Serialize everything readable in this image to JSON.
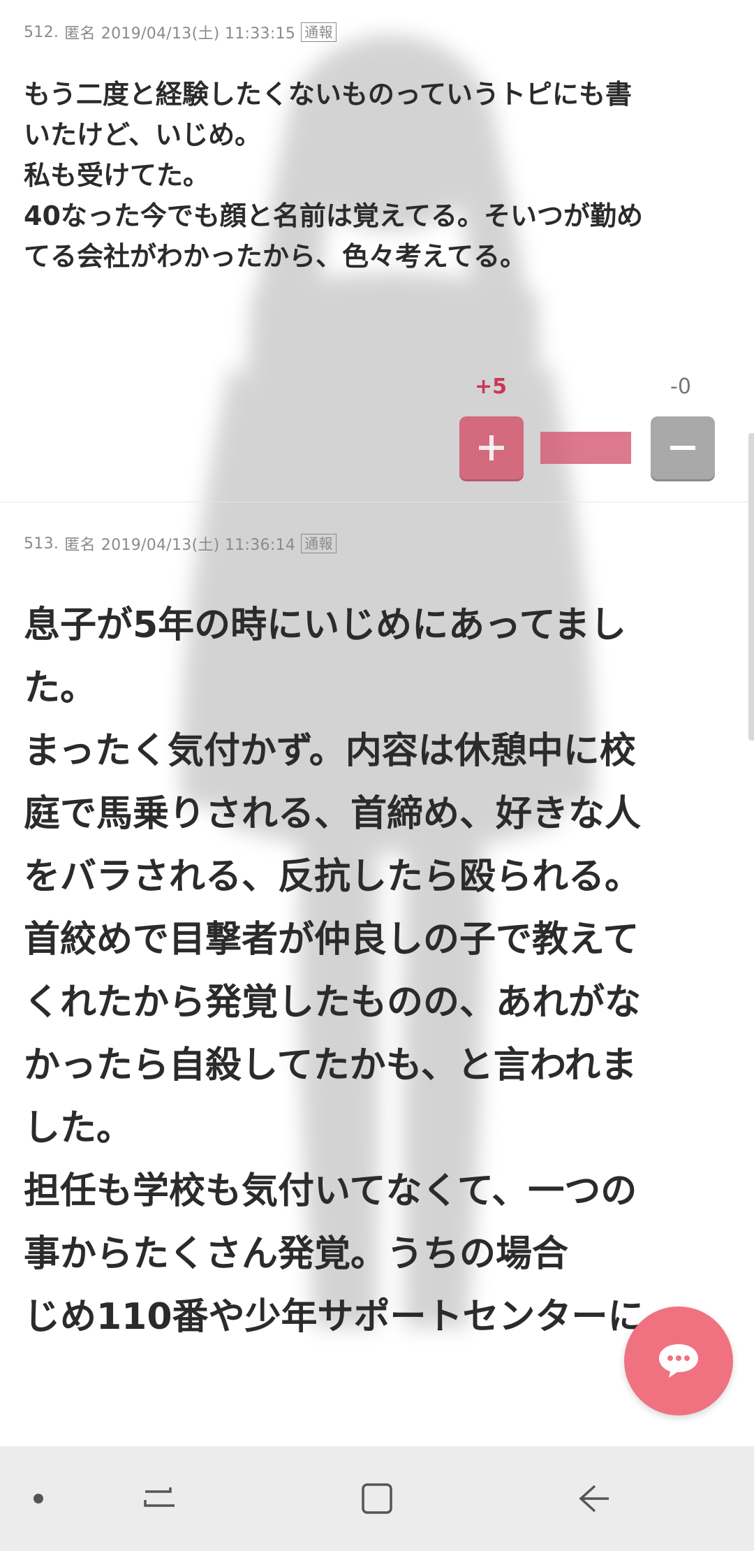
{
  "comments": [
    {
      "number": "512.",
      "author": "匿名",
      "datetime": "2019/04/13(土) 11:33:15",
      "report_label": "通報",
      "lines": [
        "もう二度と経験したくないものっていうトピにも書",
        "いたけど、いじめ。",
        "私も受けてた。",
        "40なった今でも顔と名前は覚えてる。そいつが勤め",
        "てる会社がわかったから、色々考えてる。"
      ],
      "plus_count": "+5",
      "minus_count": "-0",
      "plus_ratio": 1.0
    },
    {
      "number": "513.",
      "author": "匿名",
      "datetime": "2019/04/13(土) 11:36:14",
      "report_label": "通報",
      "lines": [
        "息子が5年の時にいじめにあってまし",
        "た。",
        "まったく気付かず。内容は休憩中に校",
        "庭で馬乗りされる、首締め、好きな人",
        "をバラされる、反抗したら殴られる。",
        "首絞めで目撃者が仲良しの子で教えて",
        "くれたから発覚したものの、あれがな",
        "かったら自殺してたかも、と言われま",
        "した。",
        "担任も学校も気付いてなくて、一つの",
        "事からたくさん発覚。うちの場合",
        "じめ110番や少年サポートセンターに"
      ]
    }
  ],
  "icons": {
    "plus": "plus-icon",
    "minus": "minus-icon",
    "chat": "chat-bubble-icon",
    "nav_dot": "dot-icon",
    "nav_recents": "recents-icon",
    "nav_home": "home-icon",
    "nav_back": "back-icon"
  },
  "colors": {
    "accent_pink": "#d45870",
    "fab": "#f07280",
    "navbar": "#ececec"
  }
}
